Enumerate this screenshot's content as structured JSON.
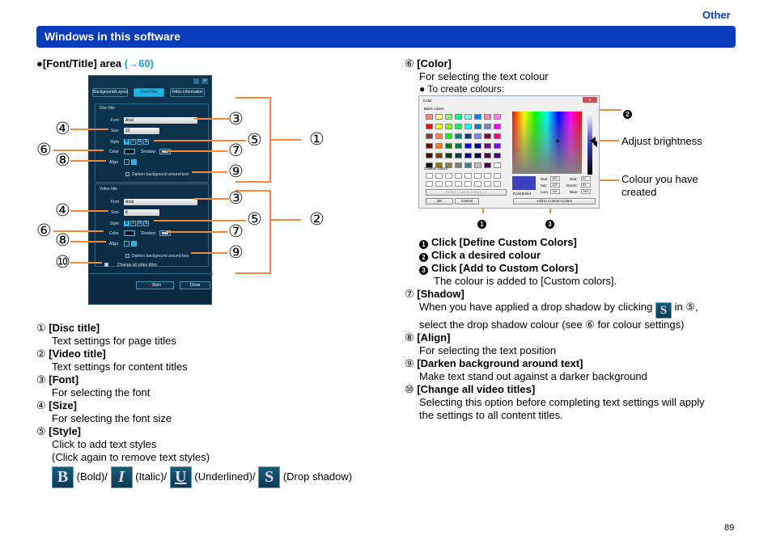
{
  "header": {
    "section": "Other",
    "title": "Windows in this software",
    "page": "89"
  },
  "left": {
    "heading": "[Font/Title] area",
    "heading_link": "(→60)",
    "callouts": {
      "n1": "①",
      "n2": "②",
      "n3": "③",
      "n4": "④",
      "n5": "⑤",
      "n6": "⑥",
      "n7": "⑦",
      "n8": "⑧",
      "n9": "⑨",
      "n10": "⑩"
    },
    "items": [
      {
        "num": "①",
        "title": "[Disc title]",
        "desc": "Text settings for page titles"
      },
      {
        "num": "②",
        "title": "[Video title]",
        "desc": "Text settings for content titles"
      },
      {
        "num": "③",
        "title": "[Font]",
        "desc": "For selecting the font"
      },
      {
        "num": "④",
        "title": "[Size]",
        "desc": "For selecting the font size"
      },
      {
        "num": "⑤",
        "title": "[Style]",
        "desc": "Click to add text styles",
        "desc2": "(Click again to remove text styles)"
      }
    ],
    "style_buttons": [
      {
        "glyph": "B",
        "label": "(Bold)/"
      },
      {
        "glyph": "I",
        "label": "(Italic)/"
      },
      {
        "glyph": "U",
        "label": "(Underlined)/"
      },
      {
        "glyph": "S",
        "label": "(Drop shadow)"
      }
    ]
  },
  "app": {
    "tabs": [
      "Background/Layout",
      "Font/Title",
      "Video information"
    ],
    "active_tab": "Font/Title",
    "disc": {
      "group": "Disc title",
      "font_label": "Font",
      "font": "Arial",
      "size_label": "Size",
      "size": "22",
      "style_label": "Style",
      "color_label": "Color",
      "shadow_label": "Shadow",
      "align_label": "Align",
      "darken": "Darken background around text"
    },
    "video": {
      "group": "Video title",
      "font_label": "Font",
      "font": "Arial",
      "size_label": "Size",
      "size": "8",
      "style_label": "Style",
      "color_label": "Color",
      "shadow_label": "Shadow",
      "align_label": "Align",
      "darken": "Darken background around text",
      "change_all": "Change all video titles"
    },
    "style_glyphs": [
      "B",
      "I",
      "U",
      "S"
    ],
    "burn": "Burn",
    "close": "Close"
  },
  "right": {
    "item6": {
      "num": "⑥",
      "title": "[Color]",
      "desc": "For selecting the text colour",
      "bullet": "To create colours:"
    },
    "steps": [
      {
        "num": "1",
        "text": "Click [Define Custom Colors]"
      },
      {
        "num": "2",
        "text": "Click a desired colour"
      },
      {
        "num": "3",
        "text": "Click [Add to Custom Colors]"
      }
    ],
    "step_note": "The colour is added to [Custom colors].",
    "item7": {
      "num": "⑦",
      "title": "[Shadow]",
      "desc_a": "When you have applied a drop shadow by clicking",
      "desc_b": "in ⑤,",
      "desc2": "select the drop shadow colour (see ⑥ for colour settings)",
      "icon_glyph": "S"
    },
    "item8": {
      "num": "⑧",
      "title": "[Align]",
      "desc": "For selecting the text position"
    },
    "item9": {
      "num": "⑨",
      "title": "[Darken background around text]",
      "desc": "Make text stand out against a darker background"
    },
    "item10": {
      "num": "⑩",
      "title": "[Change all video titles]",
      "desc": "Selecting this option before completing text settings will apply",
      "desc2": "the settings to all content titles."
    },
    "annot_brightness": "Adjust brightness",
    "annot_created1": "Colour you have",
    "annot_created2": "created"
  },
  "color_dialog": {
    "title": "Color",
    "close": "X",
    "basic_label": "Basic colors:",
    "custom_label": "Custom colors:",
    "define_btn": "Define Custom Colors >>",
    "ok": "OK",
    "cancel": "Cancel",
    "color_solid": "Color|Solid",
    "add_btn": "Add to Custom Colors",
    "hue_label": "Hue:",
    "hue": "160",
    "sat_label": "Sat:",
    "sat": "120",
    "lum_label": "Lum:",
    "lum": "118",
    "red_label": "Red:",
    "red": "62",
    "green_label": "Green:",
    "green": "65",
    "blue_label": "Blue:",
    "blue": "188",
    "selected_color": "#3e41bc",
    "palette": [
      "#FF8080",
      "#FFFF80",
      "#80FF80",
      "#00FF80",
      "#80FFFF",
      "#0080FF",
      "#FF80C0",
      "#FF80FF",
      "#FF0000",
      "#FFFF00",
      "#80FF00",
      "#00FF40",
      "#00FFFF",
      "#0080C0",
      "#8080C0",
      "#FF00FF",
      "#804040",
      "#FF8040",
      "#00FF00",
      "#008080",
      "#004080",
      "#8080FF",
      "#800040",
      "#FF0080",
      "#800000",
      "#FF8000",
      "#008000",
      "#008040",
      "#0000FF",
      "#0000A0",
      "#800080",
      "#8000FF",
      "#400000",
      "#804000",
      "#004000",
      "#004040",
      "#000080",
      "#000040",
      "#400040",
      "#400080",
      "#000000",
      "#808000",
      "#808040",
      "#808080",
      "#408080",
      "#C0C0C0",
      "#400040",
      "#FFFFFF"
    ]
  },
  "colors": {
    "header_bg": "#0a3bb8",
    "callout": "#f08a3c",
    "link": "#1aa0d8"
  }
}
